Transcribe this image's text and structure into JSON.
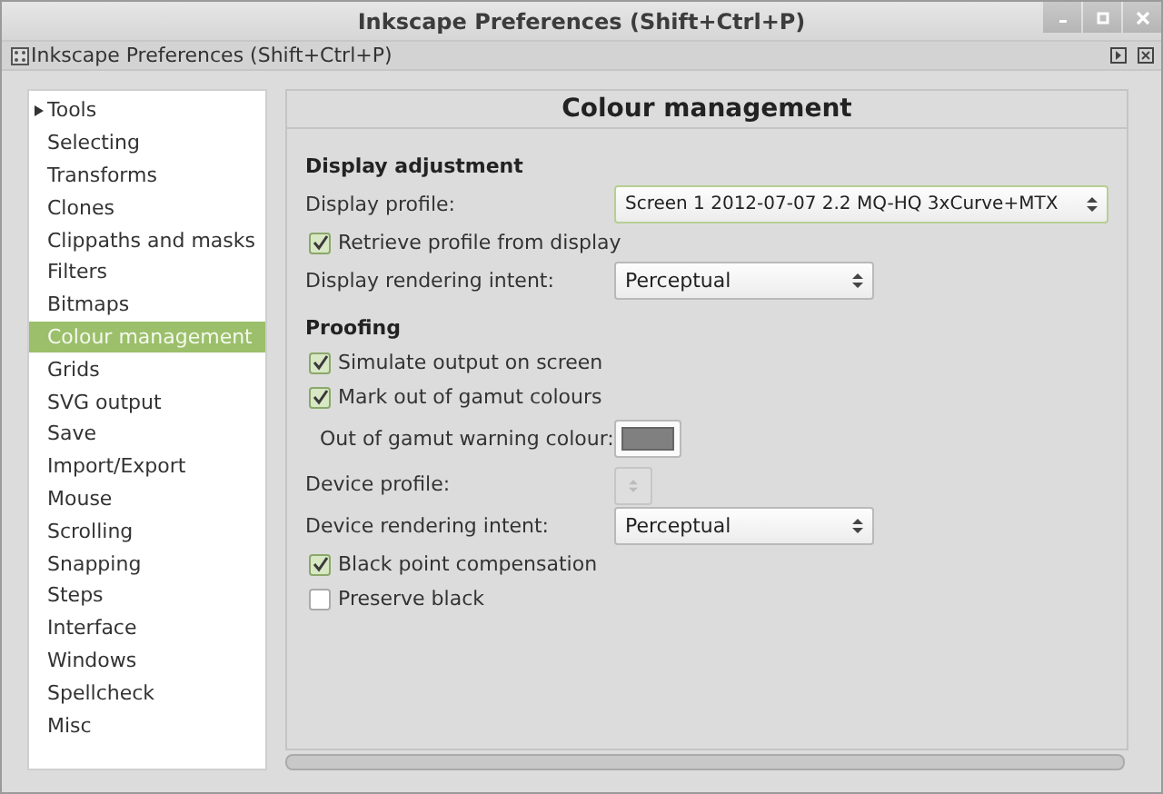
{
  "window": {
    "title": "Inkscape Preferences (Shift+Ctrl+P)"
  },
  "dock": {
    "title": "Inkscape Preferences (Shift+Ctrl+P)"
  },
  "sidebar": {
    "items": [
      {
        "label": "Tools",
        "selected": false,
        "expandable": true
      },
      {
        "label": "Selecting",
        "selected": false
      },
      {
        "label": "Transforms",
        "selected": false
      },
      {
        "label": "Clones",
        "selected": false
      },
      {
        "label": "Clippaths and masks",
        "selected": false
      },
      {
        "label": "Filters",
        "selected": false
      },
      {
        "label": "Bitmaps",
        "selected": false
      },
      {
        "label": "Colour management",
        "selected": true
      },
      {
        "label": "Grids",
        "selected": false
      },
      {
        "label": "SVG output",
        "selected": false
      },
      {
        "label": "Save",
        "selected": false
      },
      {
        "label": "Import/Export",
        "selected": false
      },
      {
        "label": "Mouse",
        "selected": false
      },
      {
        "label": "Scrolling",
        "selected": false
      },
      {
        "label": "Snapping",
        "selected": false
      },
      {
        "label": "Steps",
        "selected": false
      },
      {
        "label": "Interface",
        "selected": false
      },
      {
        "label": "Windows",
        "selected": false
      },
      {
        "label": "Spellcheck",
        "selected": false
      },
      {
        "label": "Misc",
        "selected": false
      }
    ]
  },
  "panel": {
    "title": "Colour management",
    "rows": [
      {
        "kind": "heading",
        "label": "Display adjustment"
      },
      {
        "kind": "select",
        "label": "Display profile:",
        "value": "Screen 1 2012-07-07 2.2 MQ-HQ 3xCurve+MTX",
        "wide": true
      },
      {
        "kind": "checkbox",
        "label": "Retrieve profile from display",
        "checked": true
      },
      {
        "kind": "select",
        "label": "Display rendering intent:",
        "value": "Perceptual"
      },
      {
        "kind": "heading",
        "label": "Proofing"
      },
      {
        "kind": "checkbox",
        "label": "Simulate output on screen",
        "checked": true
      },
      {
        "kind": "checkbox",
        "label": "Mark out of gamut colours",
        "checked": true
      },
      {
        "kind": "color",
        "label": "Out of gamut warning colour:",
        "color": "#808080"
      },
      {
        "kind": "spinner",
        "label": "Device profile:",
        "disabled": true
      },
      {
        "kind": "select",
        "label": "Device rendering intent:",
        "value": "Perceptual"
      },
      {
        "kind": "checkbox",
        "label": "Black point compensation",
        "checked": true
      },
      {
        "kind": "checkbox",
        "label": "Preserve black",
        "checked": false
      }
    ]
  }
}
